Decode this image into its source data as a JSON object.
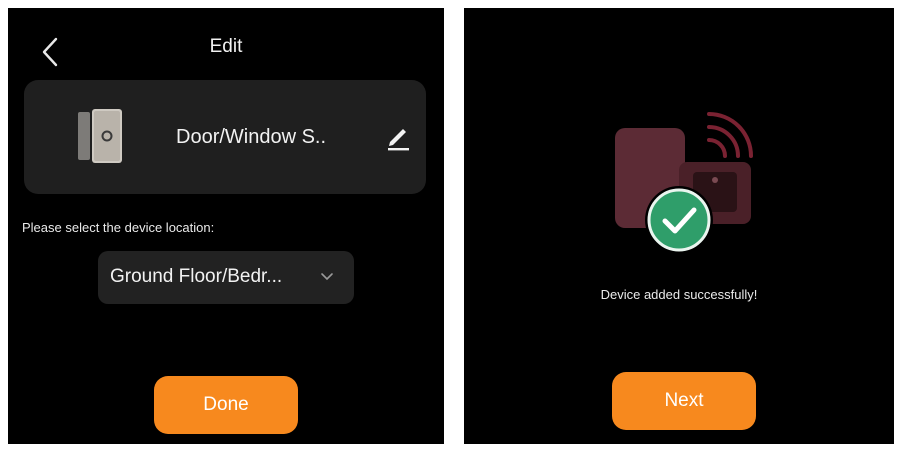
{
  "edit_screen": {
    "title": "Edit",
    "device_name": "Door/Window S..",
    "location_prompt": "Please select the device location:",
    "location_value": "Ground Floor/Bedr...",
    "done_label": "Done"
  },
  "success_screen": {
    "message": "Device added successfully!",
    "next_label": "Next"
  },
  "icons": {
    "back": "chevron-left-icon",
    "edit": "pencil-icon",
    "device": "door-window-sensor-icon",
    "dropdown": "chevron-down-icon",
    "success": "checkmark-circle-icon"
  },
  "colors": {
    "background": "#000000",
    "card": "#1f1f1f",
    "accent": "#f7891e",
    "success": "#2f9e6a"
  }
}
